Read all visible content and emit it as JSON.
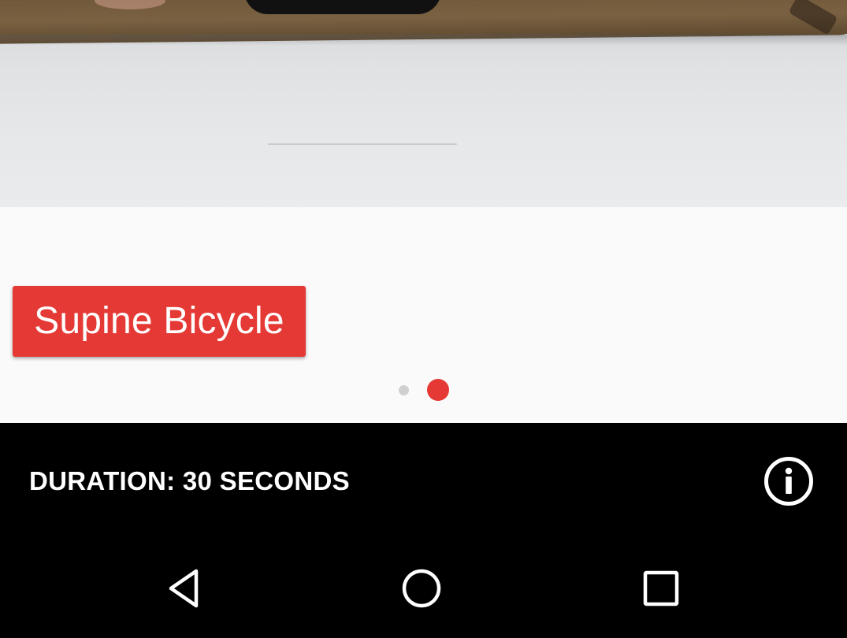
{
  "exercise": {
    "title": "Supine Bicycle",
    "duration_label": "DURATION: 30 SECONDS"
  },
  "pager": {
    "page_count": 2,
    "current_page": 2
  },
  "icons": {
    "info": "info-icon",
    "back": "back-triangle-icon",
    "home": "home-circle-icon",
    "recents": "recents-square-icon"
  },
  "colors": {
    "accent": "#e53935",
    "content_background": "#fafafa",
    "bar_background": "#000000",
    "inactive_dot": "#cfcfcf"
  }
}
